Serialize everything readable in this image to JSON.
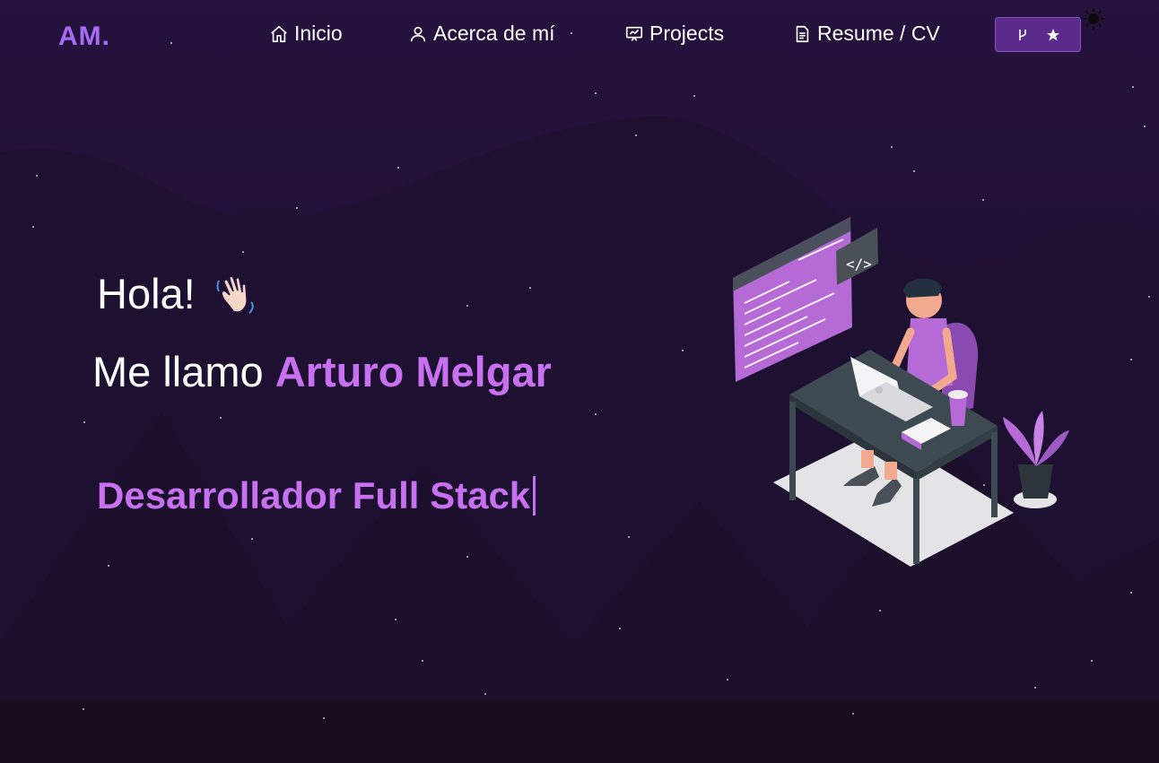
{
  "nav": {
    "logo": "AM.",
    "items": [
      {
        "label": "Inicio",
        "icon": "home-icon"
      },
      {
        "label": "Acerca de mí",
        "icon": "user-icon"
      },
      {
        "label": "Projects",
        "icon": "projects-icon"
      },
      {
        "label": "Resume / CV",
        "icon": "document-icon"
      }
    ],
    "github_button_icons": [
      "fork-icon",
      "star-icon"
    ],
    "theme_toggle_icon": "sun-icon"
  },
  "hero": {
    "greeting": "Hola!",
    "greeting_emoji": "waving-hand",
    "intro": "Me llamo",
    "name": "Arturo Melgar",
    "role": "Desarrollador Full Stack"
  },
  "colors": {
    "background": "#1a0f2b",
    "accent": "#c770f0",
    "logo": "#a56cf5",
    "button": "#5a2b8a"
  }
}
